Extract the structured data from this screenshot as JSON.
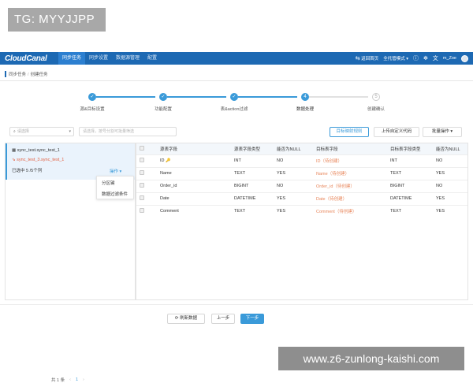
{
  "watermarks": {
    "top": "TG: MYYJJPP",
    "bottom": "www.z6-zunlong-kaishi.com"
  },
  "nav": {
    "logo": "CloudCanal",
    "items": [
      "同步任务",
      "同步设置",
      "数据源管理",
      "配置"
    ],
    "active_index": 0,
    "return_home": "返回首页",
    "mode": "全托管模式",
    "user": "m_Zoe"
  },
  "breadcrumb": {
    "parent": "同步任务",
    "current": "创建任务"
  },
  "steps": [
    {
      "label": "源&目标设置",
      "state": "done"
    },
    {
      "label": "功能配置",
      "state": "done"
    },
    {
      "label": "表&action过滤",
      "state": "done"
    },
    {
      "label": "数据处理",
      "state": "current",
      "number": "4"
    },
    {
      "label": "创建确认",
      "state": "pending",
      "number": "5"
    }
  ],
  "toolbar": {
    "select_placeholder": "请选择",
    "search_placeholder": "请选择，按号分割可批量筛选",
    "btn_mapping": "目标映射规则",
    "btn_upload": "上传自定义代码",
    "btn_batch": "批量操作"
  },
  "left_list": {
    "source_table": "sync_test.sync_test_1",
    "target_table": "sync_test_3.sync_test_1",
    "selected_cols": "已选中 5 /5个列",
    "op_label": "操作",
    "dropdown": [
      "分区键",
      "数据过滤条件"
    ],
    "total": "共 1 条",
    "page": "1"
  },
  "table": {
    "headers": [
      "源表字段",
      "源表字段类型",
      "能否为NULL",
      "目标表字段",
      "目标表字段类型",
      "能否为NULL"
    ],
    "rows": [
      {
        "src": "ID",
        "pk": true,
        "src_type": "INT",
        "src_null": "NO",
        "dst": "ID（待创建）",
        "dst_type": "INT",
        "dst_null": "NO"
      },
      {
        "src": "Name",
        "pk": false,
        "src_type": "TEXT",
        "src_null": "YES",
        "dst": "Name（待创建）",
        "dst_type": "TEXT",
        "dst_null": "YES"
      },
      {
        "src": "Order_id",
        "pk": false,
        "src_type": "BIGINT",
        "src_null": "NO",
        "dst": "Order_id（待创建）",
        "dst_type": "BIGINT",
        "dst_null": "NO"
      },
      {
        "src": "Date",
        "pk": false,
        "src_type": "DATETIME",
        "src_null": "YES",
        "dst": "Date（待创建）",
        "dst_type": "DATETIME",
        "dst_null": "YES"
      },
      {
        "src": "Comment",
        "pk": false,
        "src_type": "TEXT",
        "src_null": "YES",
        "dst": "Comment（待创建）",
        "dst_type": "TEXT",
        "dst_null": "YES"
      }
    ]
  },
  "footer": {
    "refresh": "刷新数据",
    "prev": "上一步",
    "next": "下一步"
  },
  "icons": {
    "refresh": "refresh-icon",
    "help": "help-icon",
    "settings": "settings-icon",
    "translate": "translate-icon"
  },
  "colors": {
    "brand": "#1d69b3",
    "accent": "#3a9ad9",
    "warning": "#e35d3d"
  }
}
